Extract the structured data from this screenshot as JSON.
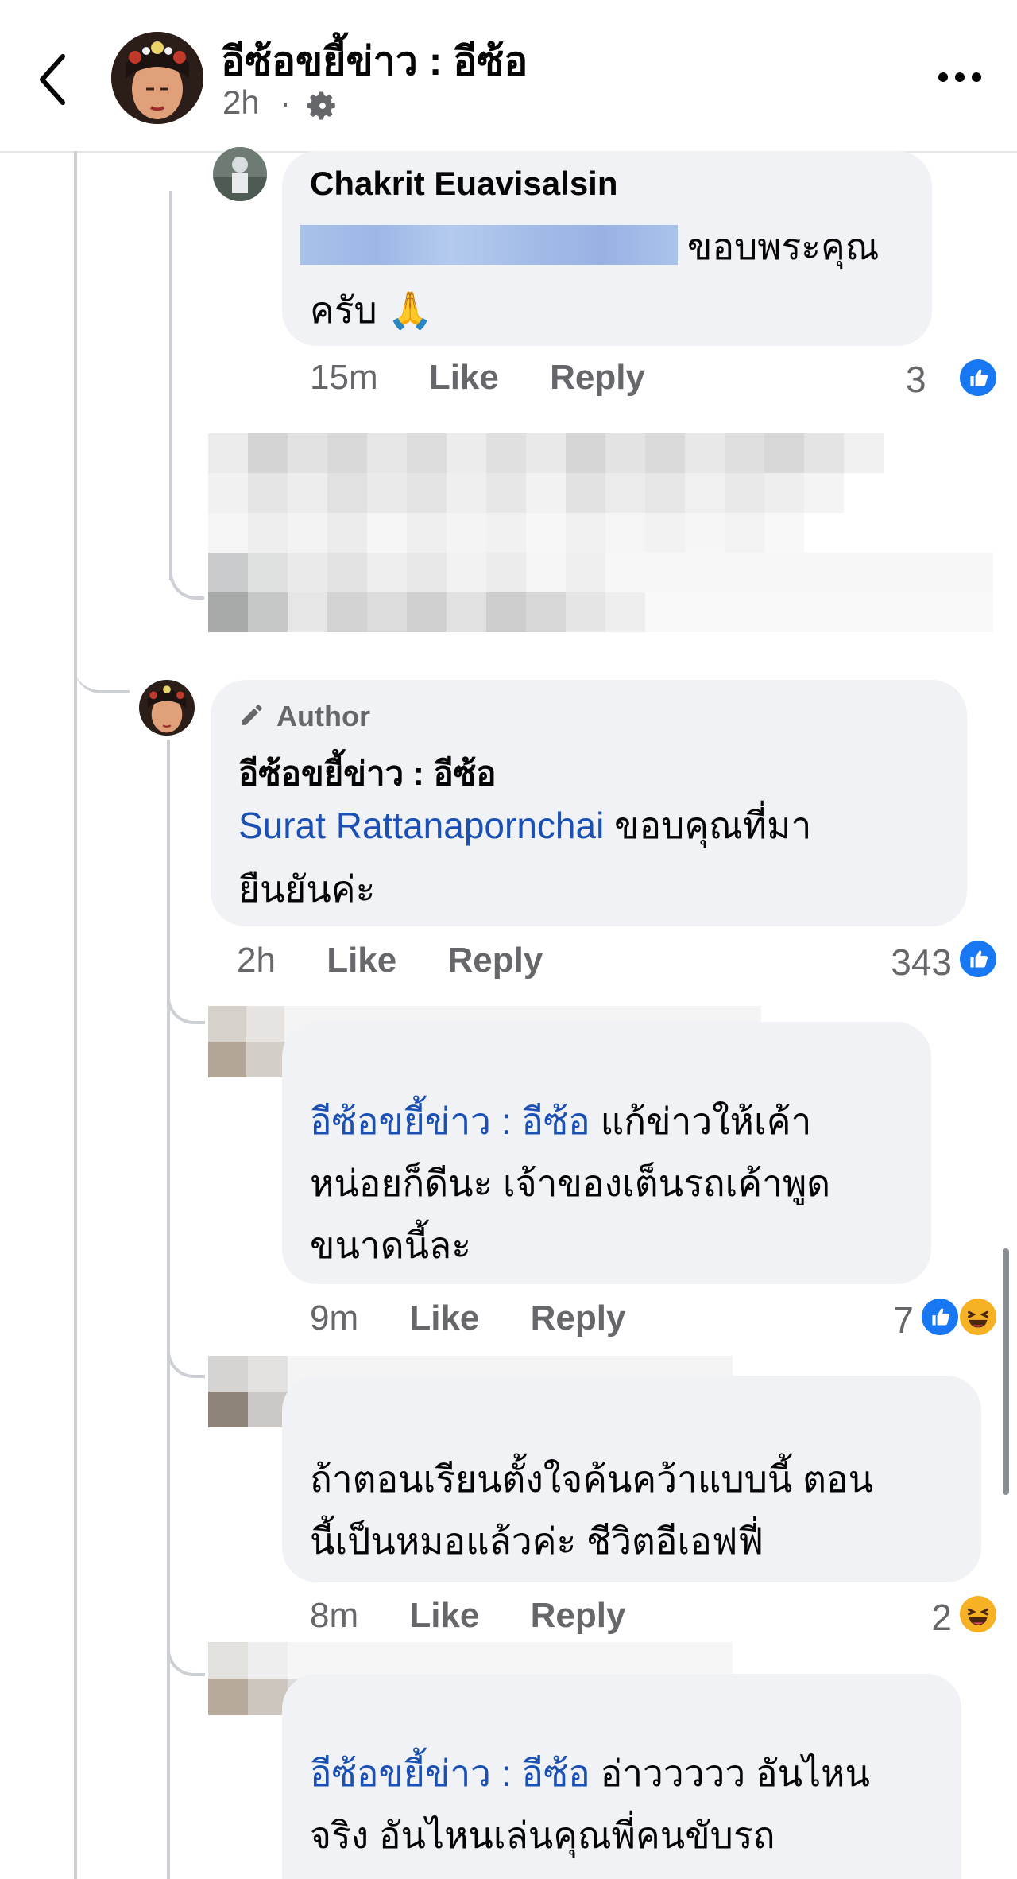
{
  "header": {
    "page_name": "อีซ้อขยี้ข่าว : อีซ้อ",
    "time": "2h",
    "separator": "·"
  },
  "comments": [
    {
      "name": "Chakrit Euavisalsin",
      "text_line1": "ขอบพระคุณ",
      "text_line2": "ครับ",
      "emoji": "🙏",
      "time": "15m",
      "like": "Like",
      "reply": "Reply",
      "reaction_count": "3"
    },
    {
      "badge": "Author",
      "name": "อีซ้อขยี้ข่าว : อีซ้อ",
      "mention": "Surat Rattanapornchai",
      "text_line1": " ขอบคุณที่มา",
      "text_line2": "ยืนยันค่ะ",
      "time": "2h",
      "like": "Like",
      "reply": "Reply",
      "reaction_count": "343"
    },
    {
      "mention": "อีซ้อขยี้ข่าว : อีซ้อ",
      "text_line1": " แก้ข่าวให้เค้า",
      "text_line2": "หน่อยก็ดีนะ เจ้าของเต็นรถเค้าพูด",
      "text_line3": "ขนาดนี้ละ",
      "time": "9m",
      "like": "Like",
      "reply": "Reply",
      "reaction_count": "7"
    },
    {
      "text_line1": "ถ้าตอนเรียนตั้งใจค้นคว้าแบบนี้ ตอน",
      "text_line2": "นี้เป็นหมอแล้วค่ะ ชีวิตอีเอฟฟี่",
      "time": "8m",
      "like": "Like",
      "reply": "Reply",
      "reaction_count": "2"
    },
    {
      "mention": "อีซ้อขยี้ข่าว : อีซ้อ",
      "text_line1": " อ่าววววว อันไหน",
      "text_line2": "จริง อันไหนเล่นคุณพี่คนขับรถ"
    }
  ],
  "colors": {
    "link": "#1a4fb4",
    "bubble": "#f0f2f5",
    "meta": "#65676b",
    "like_blue": "#1877f2",
    "haha_yellow": "#f7b125"
  }
}
